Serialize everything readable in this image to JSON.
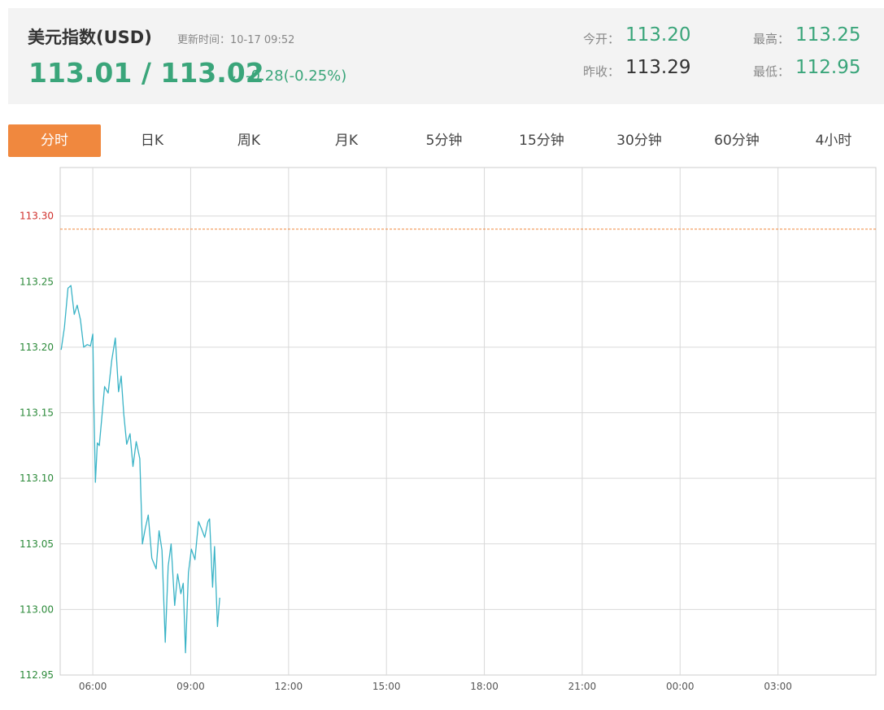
{
  "header": {
    "title": "美元指数(USD)",
    "update_time": "更新时间：10-17 09:52",
    "price": "113.01 / 113.02",
    "direction_icon": "arrow-down-icon",
    "arrow_glyph": "↓",
    "change": "-0.28(-0.25%)",
    "stats": {
      "open_label": "今开：",
      "open_value": "113.20",
      "high_label": "最高：",
      "high_value": "113.25",
      "prev_close_label": "昨收：",
      "prev_close_value": "113.29",
      "low_label": "最低：",
      "low_value": "112.95"
    },
    "colors": {
      "up_green": "#3aa57a",
      "accent_orange": "#f0883e"
    }
  },
  "tabs": [
    {
      "label": "分时",
      "active": true
    },
    {
      "label": "日K",
      "active": false
    },
    {
      "label": "周K",
      "active": false
    },
    {
      "label": "月K",
      "active": false
    },
    {
      "label": "5分钟",
      "active": false
    },
    {
      "label": "15分钟",
      "active": false
    },
    {
      "label": "30分钟",
      "active": false
    },
    {
      "label": "60分钟",
      "active": false
    },
    {
      "label": "4小时",
      "active": false
    }
  ],
  "chart_data": {
    "type": "line",
    "y_ticks": [
      "113.30",
      "113.25",
      "113.20",
      "113.15",
      "113.10",
      "113.05",
      "113.00",
      "112.95"
    ],
    "y_tick_values": [
      113.3,
      113.25,
      113.2,
      113.15,
      113.1,
      113.05,
      113.0,
      112.95
    ],
    "ylim": [
      112.95,
      113.337
    ],
    "x_ticks": [
      "06:00",
      "09:00",
      "12:00",
      "15:00",
      "18:00",
      "21:00",
      "00:00",
      "03:00"
    ],
    "x_tick_hours": [
      6,
      9,
      12,
      15,
      18,
      21,
      24,
      27
    ],
    "xlim_hours": [
      5,
      30
    ],
    "reference_line": {
      "value": 113.29,
      "color": "#f0883e",
      "style": "dashed"
    },
    "grid": true,
    "line_color": "#39b3c6",
    "series": [
      {
        "x_hours": [
          5.03,
          5.13,
          5.24,
          5.33,
          5.43,
          5.52,
          5.62,
          5.72,
          5.83,
          5.93,
          6.0,
          6.03,
          6.08,
          6.14,
          6.2,
          6.27,
          6.36,
          6.47,
          6.58,
          6.69,
          6.79,
          6.87,
          6.95,
          7.04,
          7.14,
          7.23,
          7.33,
          7.44,
          7.52,
          7.61,
          7.7,
          7.81,
          7.94,
          8.03,
          8.12,
          8.22,
          8.31,
          8.4,
          8.51,
          8.6,
          8.7,
          8.77,
          8.84,
          8.93,
          9.02,
          9.13,
          9.24,
          9.34,
          9.43,
          9.53,
          9.58,
          9.67,
          9.73,
          9.82,
          9.89
        ],
        "values": [
          113.198,
          113.215,
          113.245,
          113.247,
          113.225,
          113.232,
          113.221,
          113.2,
          113.202,
          113.201,
          113.21,
          113.16,
          113.097,
          113.127,
          113.125,
          113.145,
          113.17,
          113.165,
          113.19,
          113.207,
          113.166,
          113.178,
          113.149,
          113.126,
          113.134,
          113.109,
          113.128,
          113.115,
          113.05,
          113.062,
          113.072,
          113.039,
          113.031,
          113.06,
          113.045,
          112.975,
          113.033,
          113.05,
          113.003,
          113.027,
          113.012,
          113.02,
          112.967,
          113.028,
          113.046,
          113.038,
          113.067,
          113.061,
          113.055,
          113.067,
          113.069,
          113.017,
          113.048,
          112.987,
          113.009
        ]
      }
    ]
  }
}
